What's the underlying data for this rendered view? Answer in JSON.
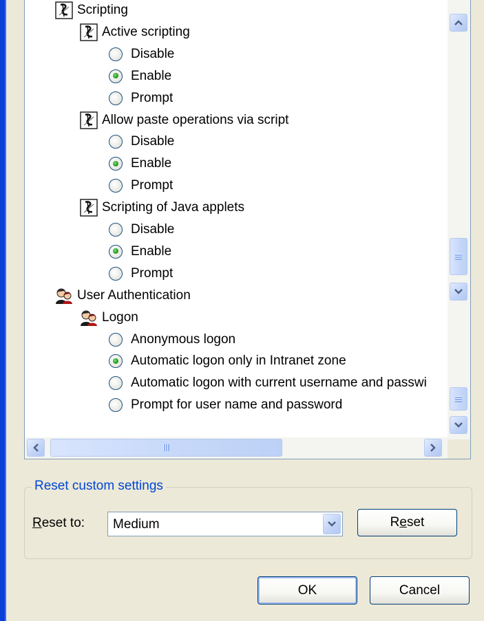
{
  "settings_tree": {
    "categories": [
      {
        "label": "Scripting",
        "icon": "script-icon",
        "settings": [
          {
            "label": "Active scripting",
            "options": [
              "Disable",
              "Enable",
              "Prompt"
            ],
            "selected": "Enable"
          },
          {
            "label": "Allow paste operations via script",
            "options": [
              "Disable",
              "Enable",
              "Prompt"
            ],
            "selected": "Enable"
          },
          {
            "label": "Scripting of Java applets",
            "options": [
              "Disable",
              "Enable",
              "Prompt"
            ],
            "selected": "Enable"
          }
        ]
      },
      {
        "label": "User Authentication",
        "icon": "users-icon",
        "settings": [
          {
            "label": "Logon",
            "options": [
              "Anonymous logon",
              "Automatic logon only in Intranet zone",
              "Automatic logon with current username and passwi",
              "Prompt for user name and password"
            ],
            "selected": "Automatic logon only in Intranet zone"
          }
        ]
      }
    ]
  },
  "reset_group": {
    "legend": "Reset custom settings",
    "reset_to_label_mnemonic": "R",
    "reset_to_label_rest": "eset to:",
    "dropdown_value": "Medium",
    "reset_button_pre": "R",
    "reset_button_mnemonic": "e",
    "reset_button_post": "set"
  },
  "dialog_buttons": {
    "ok": "OK",
    "cancel": "Cancel"
  },
  "colors": {
    "accent": "#0046d5",
    "radio_checked": "#21a121",
    "scroll_arrow": "#4d6185"
  }
}
